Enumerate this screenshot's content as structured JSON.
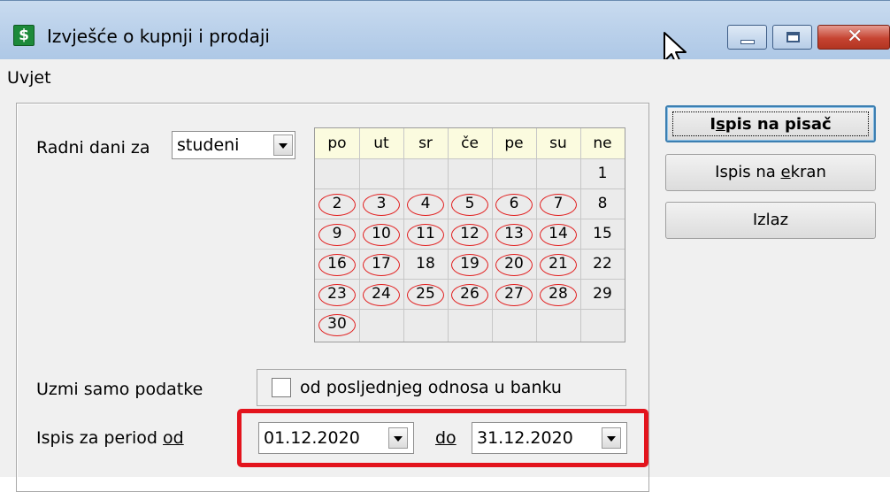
{
  "window": {
    "title": "Izvješće o kupnji i prodaji",
    "app_icon_glyph": "$",
    "icons": {
      "app": "dollar-app-icon",
      "cursor": "mouse-cursor-icon",
      "minimize": "minimize-icon",
      "maximize": "maximize-icon",
      "close": "close-icon"
    },
    "close_glyph": "✕"
  },
  "menu": {
    "items": [
      {
        "label": "Uvjet"
      }
    ]
  },
  "work_days": {
    "label": "Radni dani za",
    "month": "studeni",
    "day_names": [
      "po",
      "ut",
      "sr",
      "če",
      "pe",
      "su",
      "ne"
    ],
    "weeks": [
      [
        {
          "d": "",
          "m": false
        },
        {
          "d": "",
          "m": false
        },
        {
          "d": "",
          "m": false
        },
        {
          "d": "",
          "m": false
        },
        {
          "d": "",
          "m": false
        },
        {
          "d": "",
          "m": false
        },
        {
          "d": "1",
          "m": false
        }
      ],
      [
        {
          "d": "2",
          "m": true
        },
        {
          "d": "3",
          "m": true
        },
        {
          "d": "4",
          "m": true
        },
        {
          "d": "5",
          "m": true
        },
        {
          "d": "6",
          "m": true
        },
        {
          "d": "7",
          "m": true
        },
        {
          "d": "8",
          "m": false
        }
      ],
      [
        {
          "d": "9",
          "m": true
        },
        {
          "d": "10",
          "m": true
        },
        {
          "d": "11",
          "m": true
        },
        {
          "d": "12",
          "m": true
        },
        {
          "d": "13",
          "m": true
        },
        {
          "d": "14",
          "m": true
        },
        {
          "d": "15",
          "m": false
        }
      ],
      [
        {
          "d": "16",
          "m": true
        },
        {
          "d": "17",
          "m": true
        },
        {
          "d": "18",
          "m": false
        },
        {
          "d": "19",
          "m": true
        },
        {
          "d": "20",
          "m": true
        },
        {
          "d": "21",
          "m": true
        },
        {
          "d": "22",
          "m": false
        }
      ],
      [
        {
          "d": "23",
          "m": true
        },
        {
          "d": "24",
          "m": true
        },
        {
          "d": "25",
          "m": true
        },
        {
          "d": "26",
          "m": true
        },
        {
          "d": "27",
          "m": true
        },
        {
          "d": "28",
          "m": true
        },
        {
          "d": "29",
          "m": false
        }
      ],
      [
        {
          "d": "30",
          "m": true
        },
        {
          "d": "",
          "m": false
        },
        {
          "d": "",
          "m": false
        },
        {
          "d": "",
          "m": false
        },
        {
          "d": "",
          "m": false
        },
        {
          "d": "",
          "m": false
        },
        {
          "d": "",
          "m": false
        }
      ]
    ],
    "marked_color": "#e11d1d"
  },
  "filter": {
    "label": "Uzmi samo podatke",
    "checkbox_label": "od posljednjeg odnosa u banku",
    "checked": false
  },
  "period": {
    "label_prefix": "Ispis za period ",
    "label_access": "od",
    "from": "01.12.2020",
    "to_access": "do",
    "to": "31.12.2020",
    "highlight_color": "#e3141d"
  },
  "buttons": {
    "print_printer": {
      "pre": "I",
      "access": "s",
      "post": "pis na pisač"
    },
    "print_screen": {
      "pre": "Ispis na ",
      "access": "e",
      "post": "kran"
    },
    "exit": {
      "label": "Izlaz"
    }
  }
}
